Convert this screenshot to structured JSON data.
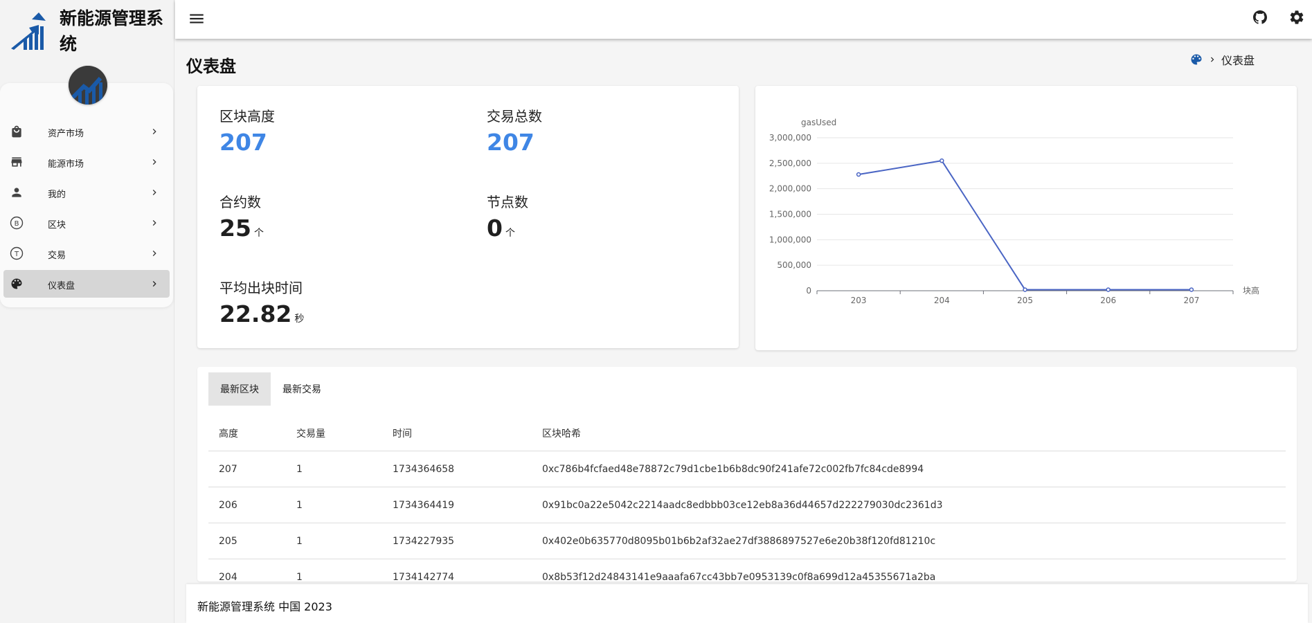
{
  "app": {
    "title": "新能源管理系统"
  },
  "sidebar": {
    "items": [
      {
        "label": "资产市场",
        "icon": "shopping-bag-icon"
      },
      {
        "label": "能源市场",
        "icon": "storefront-icon"
      },
      {
        "label": "我的",
        "icon": "person-icon"
      },
      {
        "label": "区块",
        "icon": "bitcoin-circle-icon",
        "glyph": "B"
      },
      {
        "label": "交易",
        "icon": "transaction-circle-icon",
        "glyph": "T"
      },
      {
        "label": "仪表盘",
        "icon": "palette-icon",
        "active": true
      }
    ]
  },
  "header": {
    "page_title": "仪表盘",
    "breadcrumb": "仪表盘"
  },
  "stats": {
    "block_height": {
      "label": "区块高度",
      "value": "207"
    },
    "tx_total": {
      "label": "交易总数",
      "value": "207"
    },
    "contracts": {
      "label": "合约数",
      "value": "25",
      "unit": "个"
    },
    "nodes": {
      "label": "节点数",
      "value": "0",
      "unit": "个"
    },
    "avg_block_time": {
      "label": "平均出块时间",
      "value": "22.82",
      "unit": "秒"
    }
  },
  "chart_data": {
    "type": "line",
    "ylabel": "gasUsed",
    "xlabel": "块高",
    "x": [
      "203",
      "204",
      "205",
      "206",
      "207"
    ],
    "y_ticks": [
      "0",
      "500,000",
      "1,000,000",
      "1,500,000",
      "2,000,000",
      "2,500,000",
      "3,000,000"
    ],
    "ylim": [
      0,
      3000000
    ],
    "series": [
      {
        "values": [
          2280000,
          2550000,
          21000,
          21000,
          21000
        ]
      }
    ],
    "color": "#4a65c4",
    "grid": true
  },
  "table": {
    "tabs": [
      "最新区块",
      "最新交易"
    ],
    "active_tab": 0,
    "headers": [
      "高度",
      "交易量",
      "时间",
      "区块哈希"
    ],
    "rows": [
      [
        "207",
        "1",
        "1734364658",
        "0xc786b4fcfaed48e78872c79d1cbe1b6b8dc90f241afe72c002fb7fc84cde8994"
      ],
      [
        "206",
        "1",
        "1734364419",
        "0x91bc0a22e5042c2214aadc8edbbb03ce12eb8a36d44657d222279030dc2361d3"
      ],
      [
        "205",
        "1",
        "1734227935",
        "0x402e0b635770d8095b01b6b2af32ae27df3886897527e6e20b38f120fd81210c"
      ],
      [
        "204",
        "1",
        "1734142774",
        "0x8b53f12d24843141e9aaafa67cc43bb7e0953139c0f8a699d12a45355671a2ba"
      ]
    ]
  },
  "footer": {
    "text": "新能源管理系统 中国 2023"
  },
  "colors": {
    "accent_blue": "#3f86e5",
    "chart_line": "#4a65c4",
    "logo_blue": "#1a5aa8"
  }
}
